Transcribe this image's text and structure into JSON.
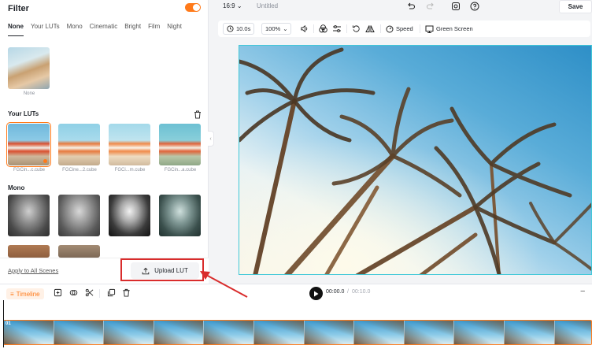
{
  "filter_panel": {
    "title": "Filter",
    "toggle_on": true,
    "tabs": [
      "None",
      "Your LUTs",
      "Mono",
      "Cinematic",
      "Bright",
      "Film",
      "Night"
    ],
    "active_tab": "None",
    "none_label": "None",
    "your_luts_title": "Your LUTs",
    "luts": [
      "FGCin...c.cube",
      "FGCine...2.cube",
      "FGCi...m.cube",
      "FGCin...a.cube"
    ],
    "mono_title": "Mono",
    "apply_link": "Apply to All Scenes",
    "upload_label": "Upload LUT"
  },
  "topbar": {
    "aspect_ratio": "16:9",
    "doc_title": "Untitled",
    "save_label": "Save"
  },
  "editor_toolbar": {
    "duration": "10.0s",
    "zoom": "100%",
    "speed_label": "Speed",
    "green_screen_label": "Green Screen"
  },
  "timeline": {
    "tab_label": "Timeline",
    "current_time": "00:00.0",
    "separator": "/",
    "total_time": "00:10.0",
    "clip_number": "01"
  },
  "colors": {
    "accent": "#ff7a1a",
    "highlight": "#d92c2c",
    "canvas_border": "#40c8d8"
  }
}
